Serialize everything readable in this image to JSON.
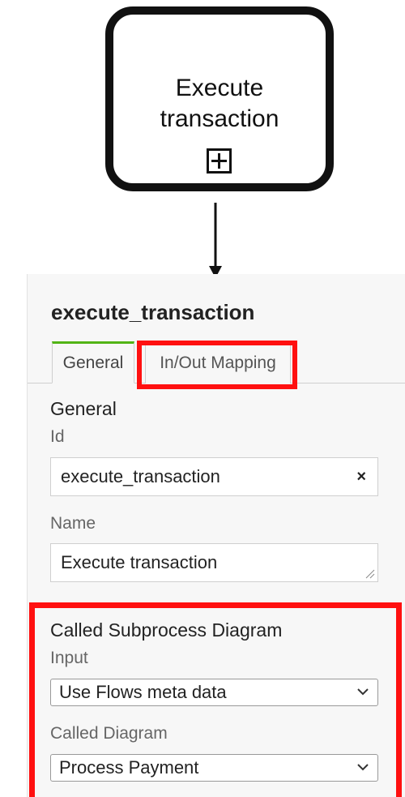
{
  "diagram": {
    "task_label": "Execute transaction",
    "marker_icon": "plus-square-icon"
  },
  "panel": {
    "title": "execute_transaction",
    "tabs": [
      {
        "label": "General",
        "active": true
      },
      {
        "label": "In/Out Mapping",
        "active": false
      }
    ],
    "general": {
      "section_title": "General",
      "id_label": "Id",
      "id_value": "execute_transaction",
      "clear_symbol": "×",
      "name_label": "Name",
      "name_value": "Execute transaction"
    },
    "called_subprocess": {
      "section_title": "Called Subprocess Diagram",
      "input_label": "Input",
      "input_value": "Use Flows meta data",
      "diagram_label": "Called Diagram",
      "diagram_value": "Process Payment"
    }
  },
  "colors": {
    "highlight": "#ff1010",
    "active_tab_accent": "#52b415"
  }
}
